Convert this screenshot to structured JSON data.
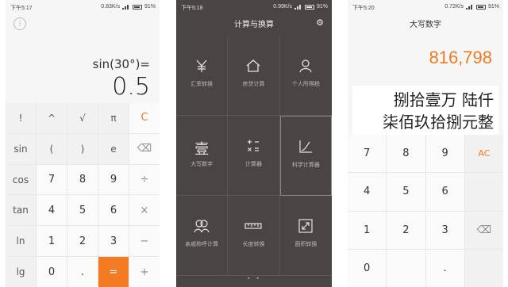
{
  "screen1": {
    "status": {
      "time": "下午5:17",
      "speed": "0.83K/s",
      "battery": "91%"
    },
    "expression": "sin(30°)=",
    "result": "0.5",
    "keys": [
      {
        "label": "!",
        "kind": "fn"
      },
      {
        "label": "^",
        "kind": "fn"
      },
      {
        "label": "√",
        "kind": "fn"
      },
      {
        "label": "π",
        "kind": "fn"
      },
      {
        "label": "C",
        "kind": "c"
      },
      {
        "label": "sin",
        "kind": "fn"
      },
      {
        "label": "(",
        "kind": "fn"
      },
      {
        "label": ")",
        "kind": "fn"
      },
      {
        "label": "e",
        "kind": "fn"
      },
      {
        "label": "⌫",
        "kind": "op"
      },
      {
        "label": "cos",
        "kind": "fn"
      },
      {
        "label": "7",
        "kind": "num"
      },
      {
        "label": "8",
        "kind": "num"
      },
      {
        "label": "9",
        "kind": "num"
      },
      {
        "label": "÷",
        "kind": "op"
      },
      {
        "label": "tan",
        "kind": "fn"
      },
      {
        "label": "4",
        "kind": "num"
      },
      {
        "label": "5",
        "kind": "num"
      },
      {
        "label": "6",
        "kind": "num"
      },
      {
        "label": "×",
        "kind": "op"
      },
      {
        "label": "ln",
        "kind": "fn"
      },
      {
        "label": "1",
        "kind": "num"
      },
      {
        "label": "2",
        "kind": "num"
      },
      {
        "label": "3",
        "kind": "num"
      },
      {
        "label": "−",
        "kind": "op"
      },
      {
        "label": "lg",
        "kind": "fn"
      },
      {
        "label": "0",
        "kind": "num"
      },
      {
        "label": ".",
        "kind": "num"
      },
      {
        "label": "=",
        "kind": "eq"
      },
      {
        "label": "+",
        "kind": "op"
      }
    ]
  },
  "screen2": {
    "status": {
      "time": "下午5:18",
      "speed": "0.99K/s",
      "battery": "91%"
    },
    "title": "计算与换算",
    "tools": [
      {
        "label": "汇率转换",
        "icon": "yen-icon"
      },
      {
        "label": "房贷计算",
        "icon": "house-icon"
      },
      {
        "label": "个人所得税",
        "icon": "person-icon"
      },
      {
        "label": "大写数字",
        "icon": "capital-number-icon",
        "glyph": "壹"
      },
      {
        "label": "计算器",
        "icon": "calculator-icon"
      },
      {
        "label": "科学计算器",
        "icon": "scientific-icon"
      },
      {
        "label": "亲戚称呼计算",
        "icon": "relatives-icon"
      },
      {
        "label": "长度转换",
        "icon": "ruler-icon"
      },
      {
        "label": "面积转换",
        "icon": "area-icon"
      }
    ]
  },
  "screen3": {
    "status": {
      "time": "下午5:20",
      "speed": "0.72K/s",
      "battery": "91%"
    },
    "title": "大写数字",
    "number": "816,798",
    "words_line1": "捌拾壹万 陆仟",
    "words_line2": "柒佰玖拾捌元整",
    "keys": [
      {
        "label": "7",
        "kind": "num"
      },
      {
        "label": "8",
        "kind": "num"
      },
      {
        "label": "9",
        "kind": "num"
      },
      {
        "label": "AC",
        "kind": "side"
      },
      {
        "label": "4",
        "kind": "num"
      },
      {
        "label": "5",
        "kind": "num"
      },
      {
        "label": "6",
        "kind": "num"
      },
      {
        "label": "",
        "kind": "side-blank"
      },
      {
        "label": "1",
        "kind": "num"
      },
      {
        "label": "2",
        "kind": "num"
      },
      {
        "label": "3",
        "kind": "num"
      },
      {
        "label": "⌫",
        "kind": "del"
      },
      {
        "label": "0",
        "kind": "num"
      },
      {
        "label": "",
        "kind": "num"
      },
      {
        "label": ".",
        "kind": "num"
      },
      {
        "label": "",
        "kind": "del-blank"
      }
    ]
  }
}
